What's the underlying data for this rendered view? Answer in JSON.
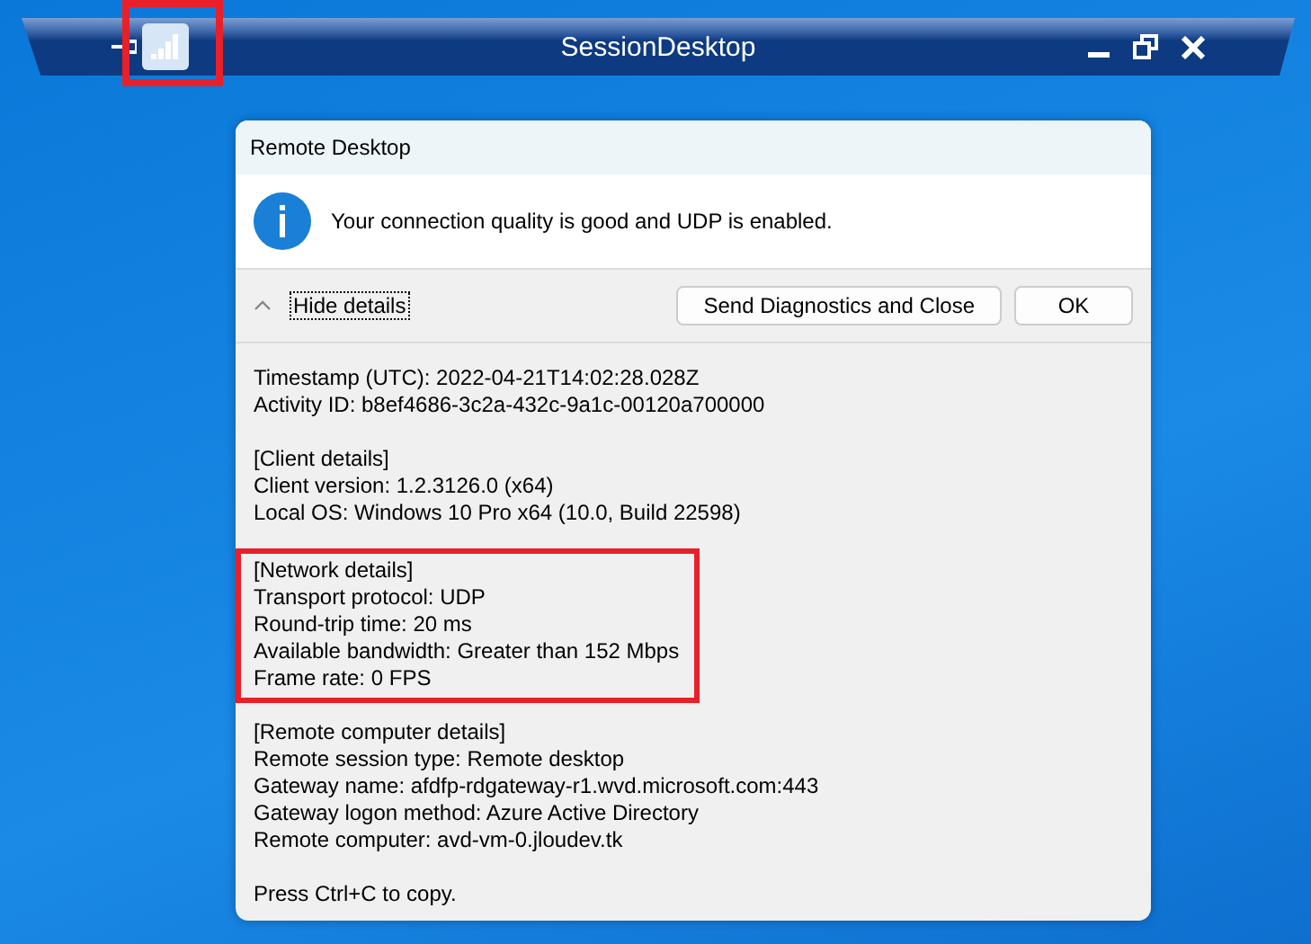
{
  "connection_bar": {
    "title": "SessionDesktop",
    "signal_highlighted": true
  },
  "dialog": {
    "title": "Remote Desktop",
    "message": "Your connection quality is good and UDP is enabled.",
    "toggle": {
      "label": "Hide details",
      "expanded": true
    },
    "buttons": [
      "Send Diagnostics and Close",
      "OK"
    ],
    "sections": [
      {
        "highlighted": false,
        "lines": [
          "Timestamp (UTC): 2022-04-21T14:02:28.028Z",
          "Activity ID: b8ef4686-3c2a-432c-9a1c-00120a700000"
        ]
      },
      {
        "highlighted": false,
        "lines": [
          "[Client details]",
          "Client version: 1.2.3126.0 (x64)",
          "Local OS: Windows 10 Pro x64 (10.0, Build 22598)"
        ]
      },
      {
        "highlighted": true,
        "lines": [
          "[Network details]",
          "Transport protocol: UDP",
          "Round-trip time: 20 ms",
          "Available bandwidth: Greater than 152 Mbps",
          "Frame rate: 0 FPS"
        ]
      },
      {
        "highlighted": false,
        "lines": [
          "[Remote computer details]",
          "Remote session type: Remote desktop",
          "Gateway name: afdfp-rdgateway-r1.wvd.microsoft.com:443",
          "Gateway logon method: Azure Active Directory",
          "Remote computer: avd-vm-0.jloudev.tk"
        ]
      },
      {
        "highlighted": false,
        "lines": [
          "Press Ctrl+C to copy."
        ]
      }
    ]
  }
}
